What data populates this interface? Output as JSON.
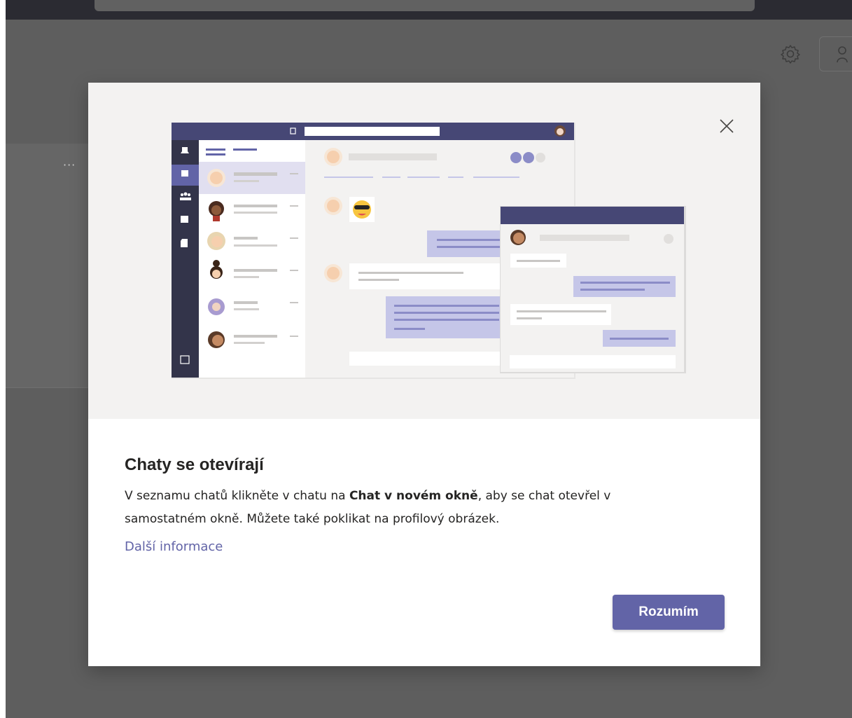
{
  "dialog": {
    "title": "Chaty se otevírají",
    "body_part1": "V seznamu chatů klikněte v chatu na ",
    "body_bold": "Chat v novém okně",
    "body_part2": ", aby se chat otevřel v",
    "body_line2": "samostatném okně. Můžete také poklikat na profilový obrázek.",
    "more_link": "Další informace",
    "confirm_label": "Rozumím",
    "close_icon": "close-icon"
  },
  "background": {
    "more_options": "···",
    "icons": [
      "gear-icon",
      "people-icon"
    ]
  },
  "colors": {
    "brand": "#6264a7",
    "header": "#464775",
    "hero_bg": "#f3f2f1",
    "overlay": "#5e5e5e"
  }
}
